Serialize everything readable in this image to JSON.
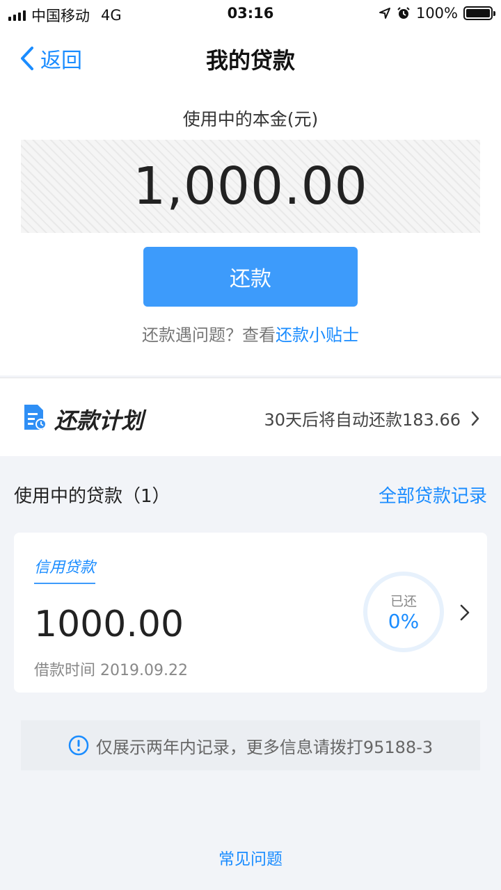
{
  "status_bar": {
    "carrier": "中国移动",
    "network": "4G",
    "time": "03:16",
    "battery": "100%",
    "battery_level": 1.0
  },
  "nav": {
    "back_label": "返回",
    "title": "我的贷款"
  },
  "principal": {
    "label": "使用中的本金(元)",
    "amount": "1,000.00"
  },
  "repay_button": {
    "label": "还款"
  },
  "help": {
    "text": "还款遇问题？查看",
    "link": "还款小贴士"
  },
  "plan": {
    "title": "还款计划",
    "info": "30天后将自动还款183.66"
  },
  "loans_section": {
    "title": "使用中的贷款（1）",
    "all_records": "全部贷款记录",
    "loans": [
      {
        "type": "信用贷款",
        "amount": "1000.00",
        "date_label": "借款时间 2019.09.22",
        "repaid_label": "已还",
        "repaid_value": "0%"
      }
    ]
  },
  "notice": {
    "text": "仅展示两年内记录，更多信息请拨打95188-3"
  },
  "footer": {
    "faq": "常见问题"
  },
  "colors": {
    "accent": "#1a8cff",
    "button": "#3d9bfb",
    "background": "#f2f4f8"
  }
}
